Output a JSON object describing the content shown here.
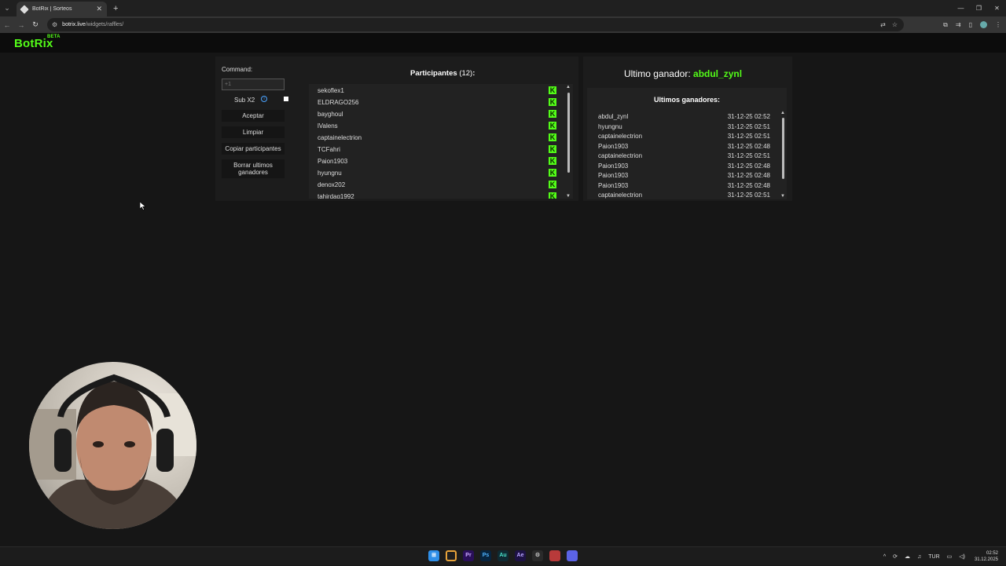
{
  "browser": {
    "tab_title": "BotRix | Sorteos",
    "url_host": "botrix.live",
    "url_path": "/widgets/raffles/"
  },
  "app": {
    "logo": "BotRix",
    "logo_badge": "BETA"
  },
  "controls": {
    "command_label": "Command:",
    "command_placeholder": "+1",
    "subx2_label": "Sub X2",
    "accept_label": "Aceptar",
    "clear_label": "Limpiar",
    "copy_label": "Copiar participantes",
    "delete_label_line1": "Borrar ultimos",
    "delete_label_line2": "ganadores"
  },
  "participants": {
    "title": "Participantes",
    "count": "(12)",
    "colon": ":",
    "items": [
      "sekoflex1",
      "ELDRAGO256",
      "bayghoul",
      "lValens",
      "captainelectrion",
      "TCFahri",
      "Paion1903",
      "hyungnu",
      "denox202",
      "tahirdag1992"
    ]
  },
  "winners": {
    "last_label": "Ultimo ganador:",
    "last_name": "abdul_zynl",
    "list_title": "Ultimos ganadores:",
    "items": [
      {
        "name": "abdul_zynl",
        "time": "31-12-25 02:52"
      },
      {
        "name": "hyungnu",
        "time": "31-12-25 02:51"
      },
      {
        "name": "captainelectrion",
        "time": "31-12-25 02:51"
      },
      {
        "name": "Paion1903",
        "time": "31-12-25 02:48"
      },
      {
        "name": "captainelectrion",
        "time": "31-12-25 02:51"
      },
      {
        "name": "Paion1903",
        "time": "31-12-25 02:48"
      },
      {
        "name": "Paion1903",
        "time": "31-12-25 02:48"
      },
      {
        "name": "Paion1903",
        "time": "31-12-25 02:48"
      },
      {
        "name": "captainelectrion",
        "time": "31-12-25 02:51"
      }
    ]
  },
  "taskbar": {
    "apps": [
      "Pr",
      "Ps",
      "Au",
      "Ae"
    ],
    "lang": "TUR",
    "time": "02:52",
    "date": "31.12.2025"
  },
  "colors": {
    "accent": "#53fc18",
    "info": "#4aa3ff"
  }
}
